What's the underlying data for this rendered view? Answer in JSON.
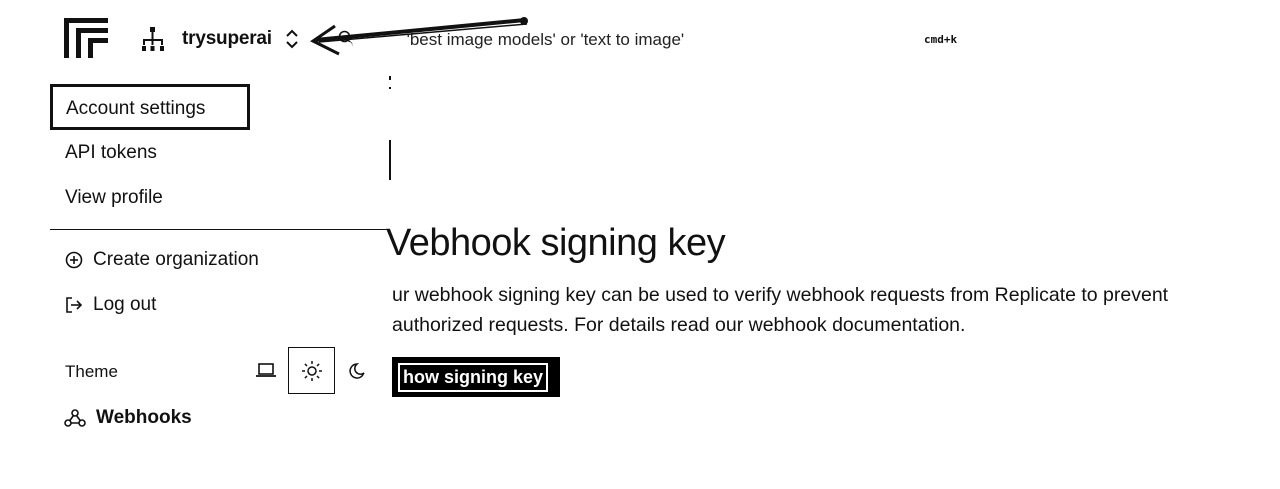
{
  "header": {
    "org_name": "trysuperai",
    "search_placeholder": "Search 'best image models' or 'text to image'",
    "search_visible_text": "'best image models' or 'text to image'",
    "shortcut": "cmd+k"
  },
  "menu": {
    "items": [
      {
        "label": "Account settings"
      },
      {
        "label": "API tokens"
      },
      {
        "label": "View profile"
      },
      {
        "label": "Create organization",
        "icon": "plus-circle-icon"
      },
      {
        "label": "Log out",
        "icon": "logout-icon"
      }
    ],
    "theme_label": "Theme",
    "theme_options": [
      "laptop-icon",
      "sun-icon",
      "moon-icon"
    ],
    "theme_selected": "sun-icon",
    "nav_webhooks": "Webhooks"
  },
  "main": {
    "title": "Vebhook signing key",
    "description": "ur webhook signing key can be used to verify webhook requests from Replicate to prevent authorized requests. For details read our webhook documentation.",
    "description_line1": "ur webhook signing key can be used to verify webhook requests from Replicate to prevent",
    "description_line2": "authorized requests. For details read our webhook documentation.",
    "show_key_button": "how signing key"
  },
  "colors": {
    "ink": "#111111",
    "background": "#ffffff"
  }
}
